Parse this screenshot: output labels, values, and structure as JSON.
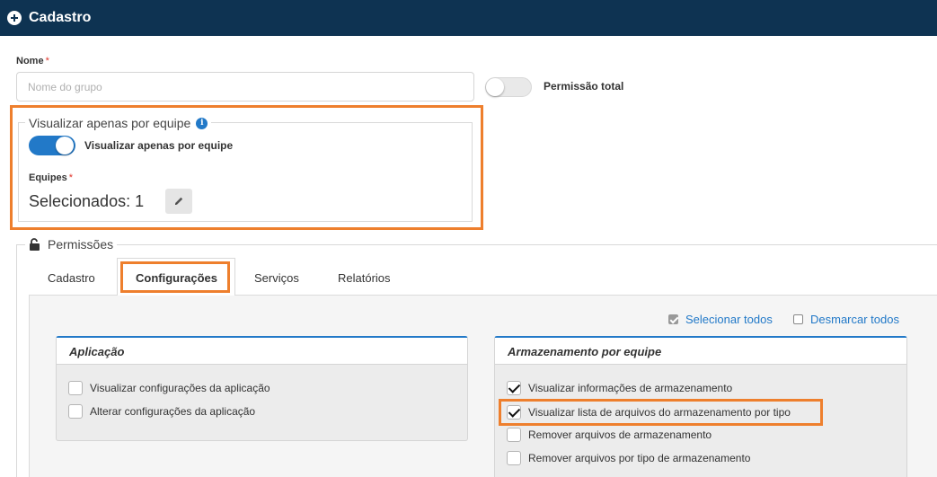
{
  "header": {
    "title": "Cadastro",
    "icon": "plus-circle-icon",
    "bg_color": "#0e3352"
  },
  "form": {
    "name_label": "Nome",
    "required_mark": "*",
    "name_placeholder": "Nome do grupo",
    "name_value": "",
    "full_permission_label": "Permissão total",
    "full_permission_on": false
  },
  "team_section": {
    "legend": "Visualizar apenas por equipe",
    "info_icon": "i",
    "toggle_label": "Visualizar apenas por equipe",
    "toggle_on": true,
    "teams_label": "Equipes",
    "selected_text": "Selecionados: 1",
    "edit_icon": "pencil-icon"
  },
  "permissions": {
    "legend": "Permissões",
    "icon": "unlock-icon",
    "tabs": [
      {
        "label": "Cadastro",
        "active": false
      },
      {
        "label": "Configurações",
        "active": true
      },
      {
        "label": "Serviços",
        "active": false
      },
      {
        "label": "Relatórios",
        "active": false
      }
    ],
    "select_all": "Selecionar todos",
    "deselect_all": "Desmarcar todos",
    "panels": [
      {
        "title": "Aplicação",
        "items": [
          {
            "label": "Visualizar configurações da aplicação",
            "checked": false
          },
          {
            "label": "Alterar configurações da aplicação",
            "checked": false
          }
        ]
      },
      {
        "title": "Armazenamento por equipe",
        "items": [
          {
            "label": "Visualizar informações de armazenamento",
            "checked": true
          },
          {
            "label": "Visualizar lista de arquivos do armazenamento por tipo",
            "checked": true
          },
          {
            "label": "Remover arquivos de armazenamento",
            "checked": false
          },
          {
            "label": "Remover arquivos por tipo de armazenamento",
            "checked": false
          }
        ]
      }
    ]
  },
  "colors": {
    "accent": "#2279c8",
    "highlight": "#ee7f2d",
    "required": "#e0352b"
  }
}
